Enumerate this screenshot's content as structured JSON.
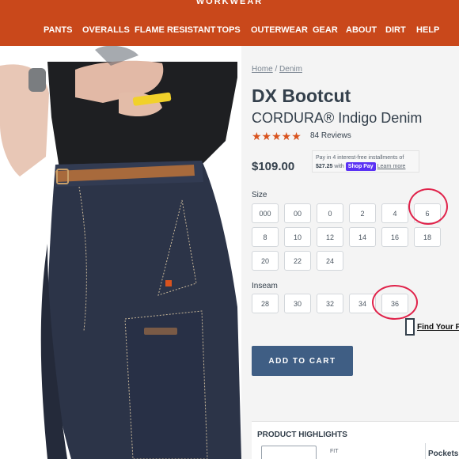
{
  "header": {
    "brand": "WORKWEAR",
    "nav": [
      "PANTS",
      "OVERALLS",
      "FLAME RESISTANT",
      "TOPS",
      "OUTERWEAR",
      "GEAR",
      "ABOUT",
      "DIRT",
      "HELP"
    ]
  },
  "breadcrumb": {
    "home": "Home",
    "separator": "/",
    "category": "Denim"
  },
  "product": {
    "title": "DX Bootcut",
    "subtitle": "CORDURA® Indigo Denim",
    "rating_stars": "★★★★★",
    "rating_value": 5,
    "reviews": "84 Reviews",
    "price": "$109.00"
  },
  "shoppay": {
    "line1": "Pay in 4 interest-free installments of",
    "amount": "$27.25",
    "with": "with",
    "logo": "Shop Pay",
    "learn_more": "Learn more"
  },
  "size": {
    "label": "Size",
    "options": [
      "000",
      "00",
      "0",
      "2",
      "4",
      "6",
      "8",
      "10",
      "12",
      "14",
      "16",
      "18",
      "20",
      "22",
      "24"
    ],
    "circled": "6"
  },
  "inseam": {
    "label": "Inseam",
    "options": [
      "28",
      "30",
      "32",
      "34",
      "36"
    ],
    "circled": "36"
  },
  "fit_link": "Find Your F",
  "add_to_cart": "ADD TO CART",
  "highlights": {
    "title": "PRODUCT HIGHLIGHTS",
    "fit": "FIT",
    "pockets": "Pockets"
  },
  "colors": {
    "header_bg": "#c9481b",
    "accent_star": "#d9531e",
    "button_bg": "#3f5e84",
    "annotation": "#e0224a",
    "denim": "#2c3448"
  },
  "icons": [
    "star-icon",
    "ruler-icon",
    "shop-pay-logo"
  ]
}
